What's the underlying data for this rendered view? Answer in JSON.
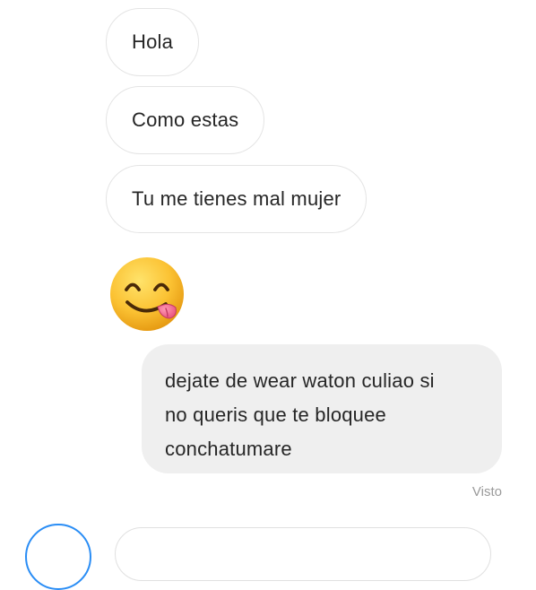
{
  "conversation": {
    "received": [
      {
        "text": "Hola"
      },
      {
        "text": "Como estas"
      },
      {
        "text": "Tu me tienes mal mujer"
      }
    ],
    "emoji_message": {
      "icon": "face-savoring-food-emoji"
    },
    "sent": {
      "lines": [
        "dejate de wear waton culiao si",
        "no queris que te bloquee",
        "conchatumare"
      ]
    },
    "seen_label": "Visto"
  },
  "colors": {
    "incoming_border": "#e4e4e4",
    "outgoing_bg": "#efefef",
    "text": "#262626",
    "seen_text": "#9a9a9a",
    "camera_ring": "#2a8df5"
  }
}
